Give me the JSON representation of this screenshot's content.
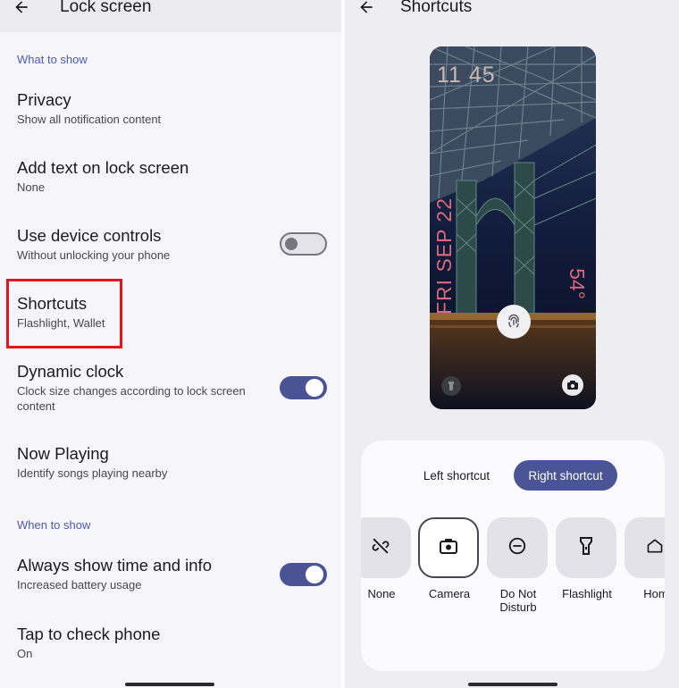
{
  "left_panel": {
    "title": "Lock screen",
    "sections": {
      "what_to_show": "What to show",
      "when_to_show": "When to show"
    },
    "settings": {
      "privacy": {
        "title": "Privacy",
        "summary": "Show all notification content"
      },
      "add_text": {
        "title": "Add text on lock screen",
        "summary": "None"
      },
      "device_controls": {
        "title": "Use device controls",
        "summary": "Without unlocking your phone",
        "enabled": false
      },
      "shortcuts": {
        "title": "Shortcuts",
        "summary": "Flashlight, Wallet"
      },
      "dynamic_clock": {
        "title": "Dynamic clock",
        "summary": "Clock size changes according to lock screen content",
        "enabled": true
      },
      "now_playing": {
        "title": "Now Playing",
        "summary": "Identify songs playing nearby"
      },
      "always_show": {
        "title": "Always show time and info",
        "summary": "Increased battery usage",
        "enabled": true
      },
      "tap_to_check": {
        "title": "Tap to check phone",
        "summary": "On"
      }
    }
  },
  "right_panel": {
    "title": "Shortcuts",
    "preview": {
      "time": "11 45",
      "date": "FRI SEP 22",
      "temperature": "54°"
    },
    "tabs": {
      "left": "Left shortcut",
      "right": "Right shortcut",
      "active": "right"
    },
    "options": [
      {
        "label": "None",
        "icon": "link-off-icon",
        "selected": false
      },
      {
        "label": "Camera",
        "icon": "camera-icon",
        "selected": true
      },
      {
        "label": "Do Not Disturb",
        "icon": "do-not-disturb-icon",
        "selected": false
      },
      {
        "label": "Flashlight",
        "icon": "flashlight-icon",
        "selected": false
      },
      {
        "label": "Hom",
        "icon": "home-icon",
        "selected": false
      }
    ]
  },
  "colors": {
    "accent": "#4b5595",
    "section_header": "#4a5bb0",
    "highlight": "#e0161c"
  }
}
